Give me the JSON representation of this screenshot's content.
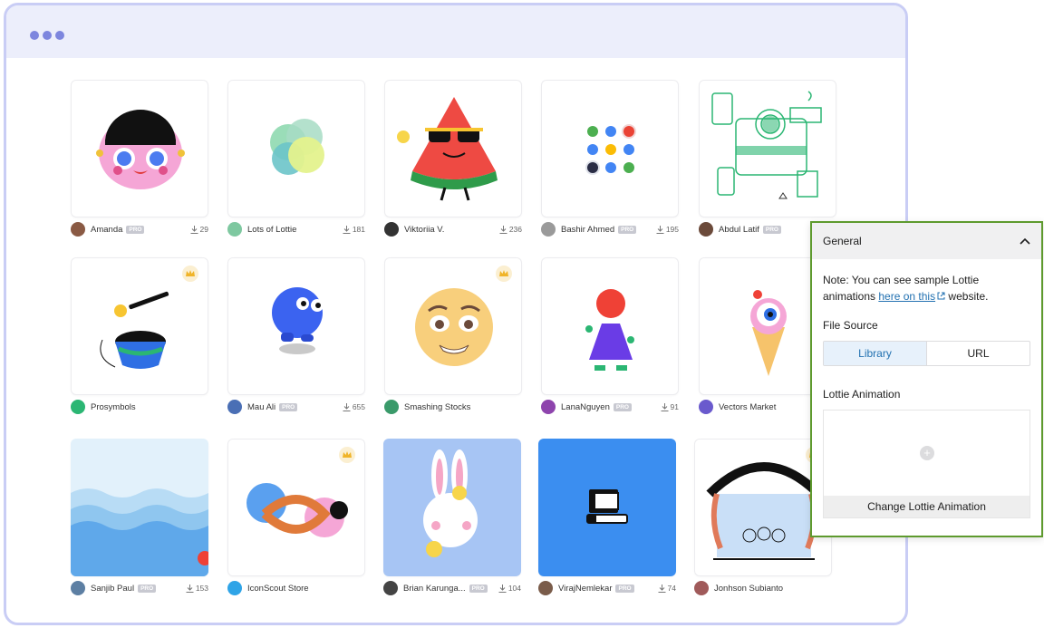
{
  "grid": {
    "items": [
      {
        "author": "Amanda",
        "pro": "PRO",
        "downloads": "29"
      },
      {
        "author": "Lots of Lottie",
        "pro": "",
        "downloads": "181"
      },
      {
        "author": "Viktoriia V.",
        "pro": "",
        "downloads": "236"
      },
      {
        "author": "Bashir Ahmed",
        "pro": "PRO",
        "downloads": "195"
      },
      {
        "author": "Abdul Latif",
        "pro": "PRO",
        "downloads": ""
      },
      {
        "author": "Prosymbols",
        "pro": "",
        "downloads": ""
      },
      {
        "author": "Mau Ali",
        "pro": "PRO",
        "downloads": "655"
      },
      {
        "author": "Smashing Stocks",
        "pro": "",
        "downloads": ""
      },
      {
        "author": "LanaNguyen",
        "pro": "PRO",
        "downloads": "91"
      },
      {
        "author": "Vectors Market",
        "pro": "",
        "downloads": ""
      },
      {
        "author": "Sanjib Paul",
        "pro": "PRO",
        "downloads": "153"
      },
      {
        "author": "IconScout Store",
        "pro": "",
        "downloads": ""
      },
      {
        "author": "Brian Karunga...",
        "pro": "PRO",
        "downloads": "104"
      },
      {
        "author": "VirajNemlekar",
        "pro": "PRO",
        "downloads": "74"
      },
      {
        "author": "Jonhson Subianto",
        "pro": "",
        "downloads": ""
      }
    ]
  },
  "panel": {
    "title": "General",
    "note_prefix": "Note: You can see sample Lottie animations ",
    "note_link": "here on this",
    "note_suffix": " website.",
    "file_source_label": "File Source",
    "source_options": [
      "Library",
      "URL"
    ],
    "selected_source": "Library",
    "lottie_label": "Lottie Animation",
    "change_button": "Change Lottie Animation"
  },
  "colors": {
    "panel_border": "#5e9a2e",
    "window_border": "#c9cdf5",
    "link": "#2271b1"
  }
}
